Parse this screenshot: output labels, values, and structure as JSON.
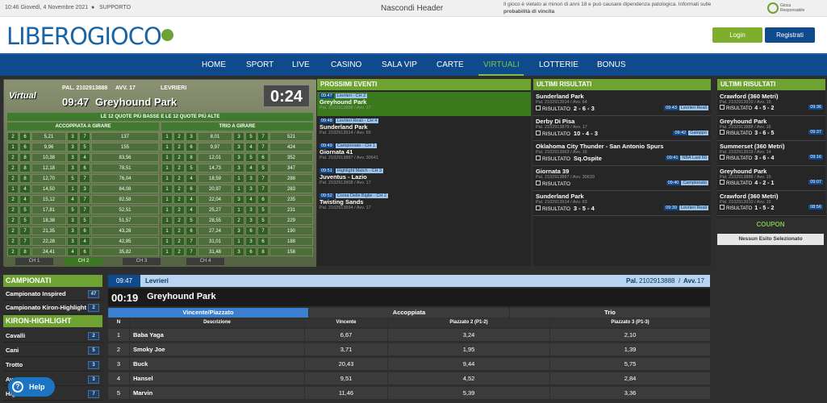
{
  "topbar": {
    "datetime": "10:46 Giovedì, 4 Novembre 2021",
    "support": "SUPPORTO",
    "hide_header": "Nascondi Header",
    "notice_line1": "Il gioco è vietato ai minori di anni 18 e può causare dipendenza patologica. Informati sulle",
    "notice_line2": "probabilità di vincita",
    "badge": "Gioca Responsabile"
  },
  "header": {
    "logo_text": "LIBEROGIOCO",
    "login": "Login",
    "register": "Registrati"
  },
  "nav": [
    "HOME",
    "SPORT",
    "LIVE",
    "CASINO",
    "SALA VIP",
    "CARTE",
    "VIRTUALI",
    "LOTTERIE",
    "BONUS"
  ],
  "virtual": {
    "badge": "Virtual",
    "pal": "PAL. 2102913888",
    "avv": "AVV. 17",
    "sport": "LEVRIERI",
    "time": "09:47",
    "event": "Greyhound Park",
    "timer": "0:24",
    "quote_banner": "LE 12 QUOTE PIÙ BASSE E LE 12 QUOTE PIÙ ALTE",
    "accoppiata_title": "ACCOPPIATA A GIRARE",
    "trio_title": "TRIO A GIRARE",
    "left_rows": [
      [
        "2",
        "6",
        "5,21",
        "3",
        "7",
        "137"
      ],
      [
        "1",
        "6",
        "9,96",
        "3",
        "5",
        "155"
      ],
      [
        "2",
        "8",
        "10,38",
        "3",
        "4",
        "83,56"
      ],
      [
        "2",
        "8",
        "12,18",
        "3",
        "6",
        "78,51"
      ],
      [
        "2",
        "8",
        "12,70",
        "5",
        "7",
        "76,04"
      ],
      [
        "1",
        "4",
        "14,50",
        "1",
        "3",
        "84,08"
      ],
      [
        "2",
        "4",
        "15,12",
        "4",
        "7",
        "82,58"
      ],
      [
        "2",
        "5",
        "17,81",
        "5",
        "7",
        "52,51"
      ],
      [
        "2",
        "5",
        "18,38",
        "3",
        "5",
        "51,57"
      ],
      [
        "2",
        "7",
        "21,35",
        "3",
        "6",
        "43,28"
      ],
      [
        "2",
        "7",
        "22,28",
        "3",
        "4",
        "42,85"
      ],
      [
        "2",
        "8",
        "24,41",
        "4",
        "6",
        "35,82"
      ]
    ],
    "right_rows": [
      [
        "1",
        "2",
        "3",
        "8,01",
        "3",
        "5",
        "7",
        "521"
      ],
      [
        "1",
        "2",
        "6",
        "9,97",
        "3",
        "4",
        "7",
        "424"
      ],
      [
        "1",
        "2",
        "8",
        "12,01",
        "3",
        "5",
        "6",
        "352"
      ],
      [
        "1",
        "2",
        "5",
        "14,73",
        "3",
        "4",
        "5",
        "347"
      ],
      [
        "1",
        "2",
        "4",
        "18,59",
        "1",
        "3",
        "7",
        "288"
      ],
      [
        "1",
        "2",
        "6",
        "20,97",
        "1",
        "3",
        "7",
        "283"
      ],
      [
        "1",
        "2",
        "4",
        "22,04",
        "3",
        "4",
        "6",
        "235"
      ],
      [
        "1",
        "2",
        "4",
        "25,27",
        "1",
        "3",
        "5",
        "231"
      ],
      [
        "1",
        "2",
        "5",
        "28,55",
        "2",
        "3",
        "5",
        "229"
      ],
      [
        "1",
        "2",
        "6",
        "27,24",
        "3",
        "6",
        "7",
        "190"
      ],
      [
        "1",
        "2",
        "7",
        "31,01",
        "1",
        "3",
        "6",
        "188"
      ],
      [
        "1",
        "2",
        "7",
        "31,48",
        "3",
        "6",
        "8",
        "158"
      ]
    ],
    "channels": [
      "CH 1",
      "CH 2",
      "CH 3",
      "CH 4"
    ]
  },
  "prossimi": {
    "title": "PROSSIMI EVENTI",
    "items": [
      {
        "time": "09:47",
        "tag": "Levrieri - CH 2",
        "name": "Greyhound Park",
        "sub": "Pal. 2102913888 / Avv. 17",
        "active": true
      },
      {
        "time": "09:48",
        "tag": "Levrieri Reali - CH 4",
        "name": "Sunderland Park",
        "sub": "Pal. 2102913914 / Avv. 65",
        "active": false
      },
      {
        "time": "09:49",
        "tag": "Campionato - CH 1",
        "name": "Giornata 41",
        "sub": "Pal. 2102913887 / Avv. 30641",
        "active": false
      },
      {
        "time": "09:51",
        "tag": "Highlight Match - CH 3",
        "name": "Juventus - Lazio",
        "sub": "Pal. 2102913908 / Avv. 17",
        "active": false
      },
      {
        "time": "09:52",
        "tag": "Corsa Delle Biglie - CH 2",
        "name": "Twisting Sands",
        "sub": "Pal. 2102913894 / Avv. 17",
        "active": false
      }
    ]
  },
  "ultimi_mid": {
    "title": "ULTIMI RISULTATI",
    "items": [
      {
        "name": "Sunderland Park",
        "sub": "Pal. 2102913914 / Avv. 64",
        "result": "2 - 6 - 3",
        "time": "09:43",
        "tag": "Levrieri Reali"
      },
      {
        "name": "Derby Di Pisa",
        "sub": "Pal. 2102913879 / Avv. 17",
        "result": "10 - 4 - 3",
        "time": "09:42",
        "tag": "Galoppo"
      },
      {
        "name": "Oklahoma City Thunder - San Antonio Spurs",
        "sub": "Pal. 2102913963 / Avv. 16",
        "result": "Sq.Ospite",
        "time": "09:41",
        "tag": "NBA Last 60"
      },
      {
        "name": "Giornata 39",
        "sub": "Pal. 2102913887 / Avv. 30639",
        "result": "",
        "time": "09:40",
        "tag": "Campionato"
      },
      {
        "name": "Sunderland Park",
        "sub": "Pal. 2102913914 / Avv. 63",
        "result": "3 - 5 - 4",
        "time": "09:39",
        "tag": "Levrieri Reali"
      }
    ],
    "result_label": "RISULTATO"
  },
  "ultimi_right": {
    "title": "ULTIMI RISULTATI",
    "items": [
      {
        "name": "Crawford (360 Metri)",
        "sub": "Pal. 2102913910 / Avv. 15",
        "result": "4 - 5 - 2",
        "time": "09:36"
      },
      {
        "name": "Greyhound Park",
        "sub": "Pal. 2102913888 / Avv. 16",
        "result": "3 - 6 - 5",
        "time": "09:37"
      },
      {
        "name": "Summerset (360 Metri)",
        "sub": "Pal. 2102913919 / Avv. 14",
        "result": "3 - 6 - 4",
        "time": "09:16"
      },
      {
        "name": "Greyhound Park",
        "sub": "Pal. 2102913888 / Avv. 15",
        "result": "4 - 2 - 1",
        "time": "09:07"
      },
      {
        "name": "Crawford (360 Metri)",
        "sub": "Pal. 2102913910 / Avv. 15",
        "result": "1 - 5 - 2",
        "time": "08:56"
      }
    ],
    "result_label": "RISULTATO"
  },
  "coupon": {
    "title": "COUPON",
    "empty": "Nessun Esito Selezionato"
  },
  "categories": {
    "campionati_title": "CAMPIONATI",
    "campionati": [
      {
        "label": "Campionato Inspired",
        "count": "47"
      },
      {
        "label": "Campionato Kiron-Highlight",
        "count": "2"
      }
    ],
    "kiron_title": "KIRON-HIGHLIGHT",
    "kiron": [
      {
        "label": "Cavalli",
        "count": "2"
      },
      {
        "label": "Cani",
        "count": "5"
      },
      {
        "label": "Trotto",
        "count": "3"
      },
      {
        "label": "Av...",
        "count": "3"
      },
      {
        "label": "Hig...",
        "count": "7"
      }
    ]
  },
  "detail": {
    "time": "09:47",
    "sport": "Levrieri",
    "pal_label": "Pal.",
    "pal": "2102913888",
    "avv_label": "Avv.",
    "avv": "17",
    "countdown": "00:19",
    "event": "Greyhound Park",
    "tabs": [
      "Vincente/Piazzato",
      "Accoppiata",
      "Trio"
    ],
    "columns": [
      "N",
      "Descrizione",
      "Vincente",
      "Piazzato 2 (P1-2)",
      "Piazzato 3 (P1-3)"
    ],
    "rows": [
      [
        "1",
        "Baba Yaga",
        "6,67",
        "3,24",
        "2,10"
      ],
      [
        "2",
        "Smoky Joe",
        "3,71",
        "1,95",
        "1,39"
      ],
      [
        "3",
        "Buck",
        "20,43",
        "9,44",
        "5,75"
      ],
      [
        "4",
        "Hansel",
        "9,51",
        "4,52",
        "2,84"
      ],
      [
        "5",
        "Marvin",
        "11,46",
        "5,39",
        "3,36"
      ]
    ]
  },
  "help": {
    "label": "Help"
  },
  "colors": {
    "green": "#6ea232",
    "blue": "#0e4a8c",
    "accent": "#7bc24a"
  }
}
